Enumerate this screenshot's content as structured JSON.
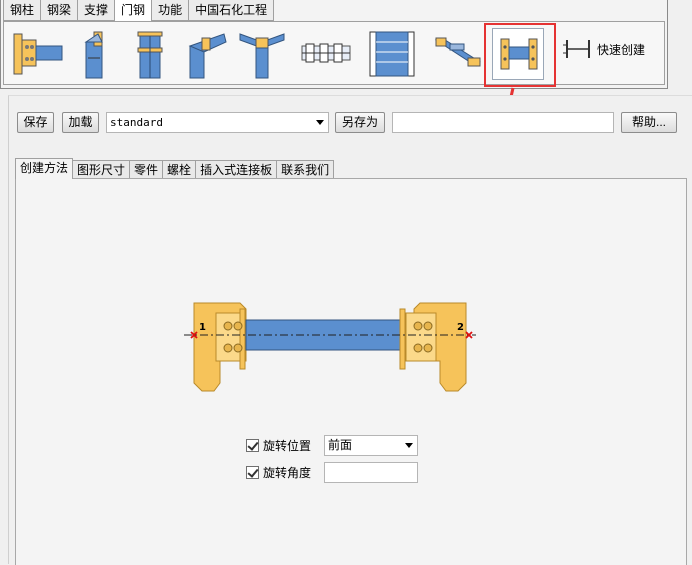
{
  "ribbon": {
    "tabs": [
      "钢柱",
      "钢梁",
      "支撑",
      "门钢",
      "功能",
      "中国石化工程"
    ],
    "active_tab": "门钢",
    "tools": [
      {
        "icon": "column-endplate-icon"
      },
      {
        "icon": "column-bracket-icon"
      },
      {
        "icon": "column-stiffener-icon"
      },
      {
        "icon": "haunch-column-icon"
      },
      {
        "icon": "ridge-joint-icon"
      },
      {
        "icon": "purlin-row-icon"
      },
      {
        "icon": "frame-grid-icon"
      },
      {
        "icon": "bracing-connection-icon"
      },
      {
        "icon": "beam-splice-icon"
      }
    ],
    "quick_create_label": "快速创建",
    "highlight_color": "#e53333"
  },
  "dialog": {
    "save_label": "保存",
    "load_label": "加载",
    "preset_value": "standard",
    "save_as_label": "另存为",
    "save_as_name": "",
    "help_label": "帮助...",
    "tabs": [
      "创建方法",
      "图形尺寸",
      "零件",
      "螺栓",
      "插入式连接板",
      "联系我们"
    ],
    "active_tab": "创建方法",
    "diagram": {
      "point_1": "1",
      "point_2": "2",
      "plate_color": "#f6c35a",
      "beam_color": "#5b8fcf"
    },
    "rotate_position_label": "旋转位置",
    "rotate_position_value": "前面",
    "rotate_angle_label": "旋转角度",
    "rotate_angle_value": ""
  }
}
